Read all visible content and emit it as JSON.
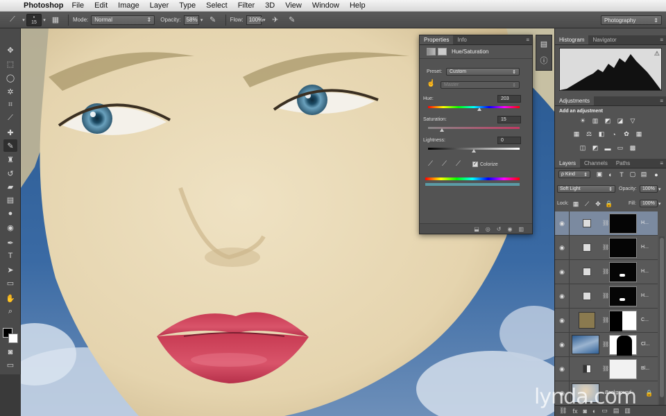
{
  "menubar": {
    "app": "Photoshop",
    "items": [
      "File",
      "Edit",
      "Image",
      "Layer",
      "Type",
      "Select",
      "Filter",
      "3D",
      "View",
      "Window",
      "Help"
    ]
  },
  "options": {
    "brush_size": "15",
    "mode_label": "Mode:",
    "mode_value": "Normal",
    "opacity_label": "Opacity:",
    "opacity_value": "58%",
    "flow_label": "Flow:",
    "flow_value": "100%",
    "workspace": "Photography"
  },
  "properties": {
    "tabs": [
      "Properties",
      "Info"
    ],
    "title": "Hue/Saturation",
    "preset_label": "Preset:",
    "preset_value": "Custom",
    "channel_value": "Master",
    "hue_label": "Hue:",
    "hue_value": "203",
    "hue_level": 203,
    "saturation_label": "Saturation:",
    "saturation_value": "15",
    "saturation_level": 15,
    "lightness_label": "Lightness:",
    "lightness_value": "0",
    "lightness_level": 0,
    "colorize_label": "Colorize",
    "colorize_checked": true
  },
  "histogram": {
    "tabs": [
      "Histogram",
      "Navigator"
    ]
  },
  "adjustments": {
    "tab": "Adjustments",
    "label": "Add an adjustment"
  },
  "layers": {
    "tabs": [
      "Layers",
      "Channels",
      "Paths"
    ],
    "filter_value": "ρ Kind",
    "blend_value": "Soft Light",
    "opacity_label": "Opacity:",
    "opacity_value": "100%",
    "lock_label": "Lock:",
    "fill_label": "Fill:",
    "fill_value": "100%",
    "rows": [
      {
        "name": "H...",
        "kind": "adjust",
        "mask": "dark",
        "selected": true
      },
      {
        "name": "H...",
        "kind": "adjust",
        "mask": "dark",
        "selected": false
      },
      {
        "name": "H...",
        "kind": "adjust",
        "mask": "lips",
        "selected": false
      },
      {
        "name": "H...",
        "kind": "adjust",
        "mask": "lips",
        "selected": false
      },
      {
        "name": "C...",
        "kind": "fill-tan",
        "mask": "face",
        "selected": false
      },
      {
        "name": "Cl...",
        "kind": "sky",
        "mask": "face2",
        "selected": false
      },
      {
        "name": "Bl...",
        "kind": "adjust-bw",
        "mask": "white",
        "selected": false
      },
      {
        "name": "Background",
        "kind": "photo",
        "mask": "none",
        "selected": false
      }
    ]
  },
  "watermark": "lynda.com",
  "colors": {
    "panel": "#535353",
    "selected_layer": "#7b8aa0"
  }
}
